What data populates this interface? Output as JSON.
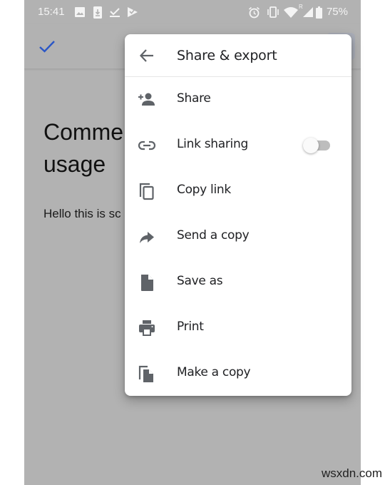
{
  "status_bar": {
    "time": "15:41",
    "left_icons": [
      "image-icon",
      "download-icon",
      "checkmark-download-icon",
      "tasks-icon"
    ],
    "right_icons": [
      "alarm-icon",
      "vibrate-icon",
      "wifi-icon",
      "signal-roaming-icon",
      "battery-icon"
    ],
    "roaming_indicator": "R",
    "battery_percent": "75%"
  },
  "toolbar": {
    "done_icon": "check-icon",
    "accent_color": "#2a56c6"
  },
  "document": {
    "title": "Comments usage",
    "title_visible_line1": "Comme",
    "title_visible_line2": "usage",
    "body_visible": "Hello this is sc"
  },
  "menu": {
    "title": "Share & export",
    "back_icon": "arrow-left-icon",
    "items": [
      {
        "label": "Share",
        "icon": "person-add-icon"
      },
      {
        "label": "Link sharing",
        "icon": "link-icon",
        "toggle": {
          "on": false
        }
      },
      {
        "label": "Copy link",
        "icon": "copy-icon"
      },
      {
        "label": "Send a copy",
        "icon": "forward-arrow-icon"
      },
      {
        "label": "Save as",
        "icon": "file-icon"
      },
      {
        "label": "Print",
        "icon": "printer-icon"
      },
      {
        "label": "Make a copy",
        "icon": "file-copy-icon"
      }
    ]
  },
  "watermark": "wsxdn.com"
}
